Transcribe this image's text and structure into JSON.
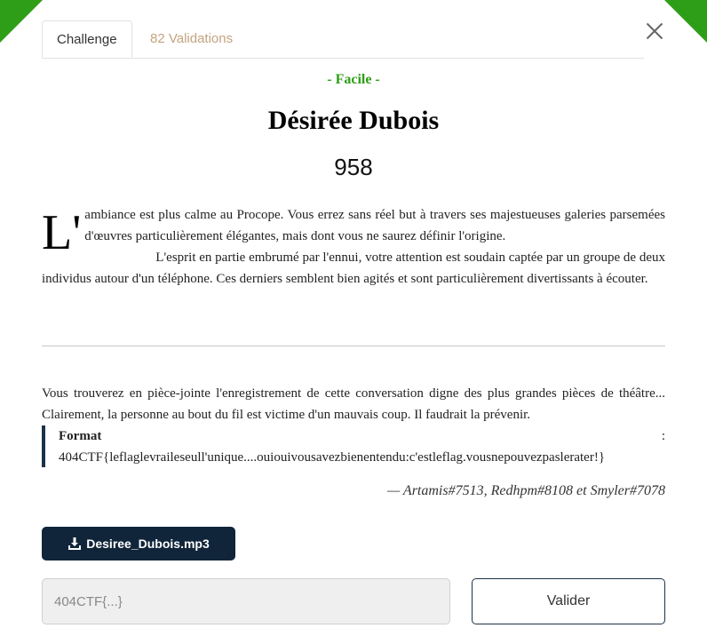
{
  "tabs": [
    {
      "label": "Challenge",
      "active": true
    },
    {
      "label": "82 Validations",
      "active": false
    }
  ],
  "difficulty": "- Facile -",
  "title": "Désirée Dubois",
  "points": "958",
  "story": {
    "dropcap": "L'",
    "paragraph1": "ambiance est plus calme au Procope. Vous errez sans réel but à travers ses majestueuses galeries parsemées d'œuvres particulièrement élégantes, mais dont vous ne saurez définir l'origine.",
    "paragraph2": "L'esprit en partie embrumé par l'ennui, votre attention est soudain captée par un groupe de deux individus autour d'un téléphone. Ces derniers semblent bien agités et sont particulièrement divertissants à écouter."
  },
  "task": "Vous trouverez en pièce-jointe l'enregistrement de cette conversation digne des plus grandes pièces de théâtre... Clairement, la personne au bout du fil est victime d'un mauvais coup. Il faudrait la prévenir.",
  "format": {
    "label": "Format",
    "colon": ":",
    "value": "404CTF{leflaglevraileseull'unique....ouiouivousavezbienentendu:c'estleflag.vousnepouvezpaslerater!}"
  },
  "authors": "— Artamis#7513, Redhpm#8108 et Smyler#7078",
  "download": {
    "label": "Desiree_Dubois.mp3",
    "icon": "download-icon"
  },
  "flag_input": {
    "placeholder": "404CTF{...}",
    "value": ""
  },
  "validate_label": "Valider",
  "colors": {
    "accent_green": "#2e9e18",
    "dark_navy": "#11253a",
    "tab_inactive": "#c4a37f"
  }
}
